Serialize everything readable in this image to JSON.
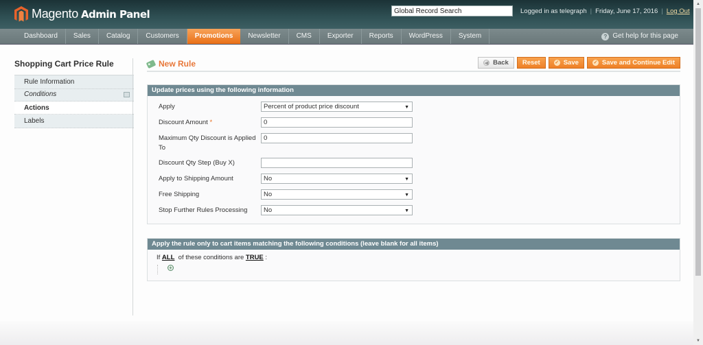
{
  "header": {
    "logo_text": "Magento",
    "logo_sub": "Admin Panel",
    "search_value": "Global Record Search",
    "logged_in": "Logged in as telegraph",
    "date": "Friday, June 17, 2016",
    "logout": "Log Out"
  },
  "nav": {
    "items": [
      "Dashboard",
      "Sales",
      "Catalog",
      "Customers",
      "Promotions",
      "Newsletter",
      "CMS",
      "Exporter",
      "Reports",
      "WordPress",
      "System"
    ],
    "active": "Promotions",
    "help": "Get help for this page"
  },
  "sidebar": {
    "title": "Shopping Cart Price Rule",
    "items": [
      {
        "label": "Rule Information"
      },
      {
        "label": "Conditions"
      },
      {
        "label": "Actions"
      },
      {
        "label": "Labels"
      }
    ]
  },
  "content": {
    "title": "New Rule",
    "buttons": {
      "back": "Back",
      "reset": "Reset",
      "save": "Save",
      "save_continue": "Save and Continue Edit"
    },
    "actions_section": {
      "heading": "Update prices using the following information",
      "fields": [
        {
          "label": "Apply",
          "value": "Percent of product price discount",
          "type": "select"
        },
        {
          "label": "Discount Amount",
          "required": "*",
          "value": "0",
          "type": "text"
        },
        {
          "label": "Maximum Qty Discount is Applied To",
          "value": "0",
          "type": "text"
        },
        {
          "label": "Discount Qty Step (Buy X)",
          "value": "",
          "type": "text"
        },
        {
          "label": "Apply to Shipping Amount",
          "value": "No",
          "type": "select"
        },
        {
          "label": "Free Shipping",
          "value": "No",
          "type": "select"
        },
        {
          "label": "Stop Further Rules Processing",
          "value": "No",
          "type": "select"
        }
      ]
    },
    "conditions_section": {
      "heading": "Apply the rule only to cart items matching the following conditions (leave blank for all items)",
      "prefix": "If",
      "aggregator": "ALL",
      "middle": "of these conditions are",
      "value": "TRUE",
      "suffix": ":"
    }
  }
}
